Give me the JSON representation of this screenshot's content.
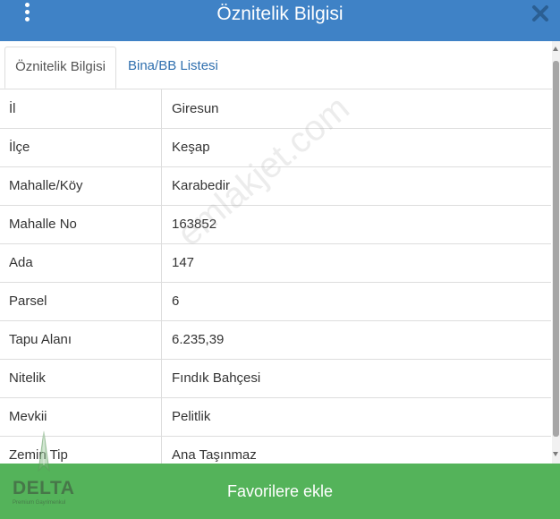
{
  "header": {
    "title": "Öznitelik Bilgisi"
  },
  "tabs": [
    {
      "label": "Öznitelik Bilgisi",
      "active": true
    },
    {
      "label": "Bina/BB Listesi",
      "active": false
    }
  ],
  "attributes": [
    {
      "key": "İl",
      "value": "Giresun"
    },
    {
      "key": "İlçe",
      "value": "Keşap"
    },
    {
      "key": "Mahalle/Köy",
      "value": "Karabedir"
    },
    {
      "key": "Mahalle No",
      "value": "163852"
    },
    {
      "key": "Ada",
      "value": "147"
    },
    {
      "key": "Parsel",
      "value": "6"
    },
    {
      "key": "Tapu Alanı",
      "value": "6.235,39"
    },
    {
      "key": "Nitelik",
      "value": "Fındık Bahçesi"
    },
    {
      "key": "Mevkii",
      "value": "Pelitlik"
    },
    {
      "key": "Zemin Tip",
      "value": "Ana Taşınmaz"
    }
  ],
  "footer": {
    "button_label": "Favorilere ekle"
  },
  "watermark": {
    "text": "emlakjet.com"
  },
  "logo": {
    "name": "DELTA",
    "tagline": "Premium Gayrimenkul"
  },
  "colors": {
    "header_blue": "#3f82c6",
    "footer_green": "#54b35a",
    "tab_link_blue": "#2f6fae"
  },
  "icons": {
    "menu": "kebab-menu-icon",
    "close": "close-icon"
  }
}
